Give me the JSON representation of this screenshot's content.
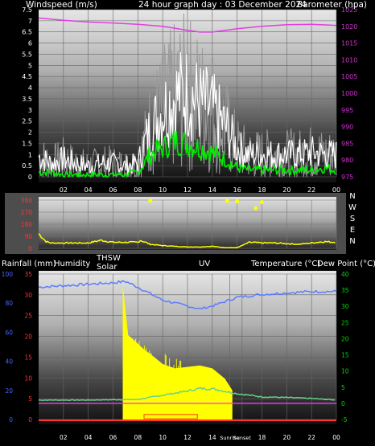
{
  "header": {
    "left": "Windspeed (m/s)",
    "center": "24 hour graph day : 03 December 2024",
    "right": "Barometer (hpa)"
  },
  "lower_header": {
    "rain": "Rainfall (mm)",
    "humidity": "Humidity",
    "thsw": "THSW",
    "solar": "Solar",
    "uv": "UV",
    "temp": "Temperature (°C)",
    "dew": "Dew Point (°C)"
  },
  "colors": {
    "wind": "#ffffff",
    "gust": "#9a9a9a",
    "avg_wind": "#00ee00",
    "barometer": "#e040e0",
    "direction": "#ffff00",
    "humidity": "#5b7cff",
    "temperature": "#66d28a",
    "dew": "#ff33ff",
    "solar": "#ffff00",
    "thsw": "#ff3333",
    "axis_red": "#ff3333",
    "axis_green": "#00dd00",
    "axis_purple": "#cc33cc"
  },
  "chart_data": [
    {
      "type": "line",
      "name": "wind-barometer",
      "x_tick_labels": [
        "02",
        "04",
        "06",
        "08",
        "10",
        "12",
        "14",
        "16",
        "18",
        "20",
        "22",
        "00"
      ],
      "y_left_ticks": [
        "0",
        "0.5",
        "1",
        "1.5",
        "2",
        "2.5",
        "3",
        "3.5",
        "4",
        "4.5",
        "5",
        "5.5",
        "6",
        "6.5",
        "7",
        "7.5"
      ],
      "y_left_range": [
        0,
        7.5
      ],
      "y_right_ticks": [
        "975",
        "980",
        "985",
        "990",
        "995",
        "1000",
        "1005",
        "1010",
        "1015",
        "1020",
        "1025"
      ],
      "y_right_range": [
        975,
        1025
      ],
      "series": [
        {
          "key": "wind",
          "x": [
            0,
            1,
            2,
            3,
            4,
            5,
            6,
            7,
            8,
            9,
            10,
            11,
            12,
            13,
            14,
            15,
            16,
            17,
            18,
            19,
            20,
            21,
            22,
            23,
            24
          ],
          "values": [
            0.9,
            0.6,
            0.8,
            0.6,
            0.5,
            0.6,
            0.6,
            0.5,
            0.6,
            2.2,
            3.0,
            3.6,
            3.8,
            3.3,
            3.0,
            2.3,
            1.3,
            1.0,
            1.0,
            1.0,
            1.0,
            1.0,
            1.1,
            1.0,
            1.0
          ]
        },
        {
          "key": "avg_wind",
          "x": [
            0,
            1,
            2,
            3,
            4,
            5,
            6,
            7,
            8,
            9,
            10,
            11,
            12,
            13,
            14,
            15,
            16,
            17,
            18,
            19,
            20,
            21,
            22,
            23,
            24
          ],
          "values": [
            0.2,
            0.2,
            0.1,
            0.1,
            0.1,
            0.1,
            0.1,
            0.1,
            0.2,
            1.0,
            1.3,
            1.6,
            1.5,
            1.3,
            1.1,
            0.8,
            0.4,
            0.3,
            0.3,
            0.3,
            0.3,
            0.3,
            0.3,
            0.4,
            0.3
          ]
        },
        {
          "key": "barometer",
          "x": [
            0,
            2,
            4,
            6,
            8,
            10,
            12,
            13,
            14,
            16,
            18,
            20,
            22,
            24
          ],
          "values": [
            1022.5,
            1021.8,
            1021.3,
            1021.0,
            1020.6,
            1020.0,
            1018.8,
            1018.3,
            1018.3,
            1019.3,
            1020.0,
            1020.5,
            1020.6,
            1020.3
          ]
        }
      ]
    },
    {
      "type": "scatter",
      "name": "wind-direction",
      "x_tick_labels": [
        "02",
        "04",
        "06",
        "08",
        "10",
        "12",
        "14",
        "16",
        "18",
        "20",
        "22",
        "00"
      ],
      "y_ticks": [
        "0",
        "90",
        "180",
        "270",
        "360"
      ],
      "y_range": [
        0,
        360
      ],
      "compass": [
        "N",
        "W",
        "S",
        "E",
        "N"
      ],
      "series": [
        {
          "key": "direction",
          "x": [
            0,
            0.3,
            0.6,
            1,
            2,
            3,
            4,
            5,
            6,
            6.4,
            7,
            8,
            8.2,
            9,
            10,
            11,
            12,
            13,
            14,
            15,
            16,
            17,
            18,
            19,
            20,
            21,
            22,
            23,
            24
          ],
          "values": [
            110,
            80,
            50,
            40,
            40,
            40,
            40,
            60,
            45,
            45,
            45,
            45,
            60,
            30,
            20,
            15,
            10,
            10,
            15,
            5,
            5,
            45,
            40,
            40,
            35,
            30,
            40,
            50,
            45
          ]
        }
      ]
    },
    {
      "type": "line",
      "name": "temperature-humidity-solar",
      "x_tick_labels": [
        "02",
        "04",
        "06",
        "08",
        "10",
        "12",
        "14",
        "Sunrise",
        "Sunset",
        "18",
        "20",
        "22",
        "00"
      ],
      "y_left_outer_ticks": [
        "0",
        "20",
        "40",
        "60",
        "80",
        "100"
      ],
      "y_left_inner_ticks": [
        "0",
        "5",
        "10",
        "15",
        "20",
        "25",
        "30",
        "35"
      ],
      "y_right_ticks": [
        "-5",
        "0",
        "5",
        "10",
        "15",
        "20",
        "25",
        "30",
        "35",
        "40"
      ],
      "y_right_range": [
        -5,
        40
      ],
      "series": [
        {
          "key": "humidity",
          "x": [
            0,
            2,
            4,
            6,
            7,
            8,
            10,
            12,
            13,
            14,
            16,
            18,
            20,
            22,
            24
          ],
          "values": [
            91,
            92,
            93,
            94,
            95,
            91,
            82,
            78,
            76,
            78,
            84,
            86,
            87,
            88,
            88
          ]
        },
        {
          "key": "temperature",
          "x": [
            0,
            2,
            4,
            6,
            8,
            10,
            12,
            13,
            14,
            16,
            18,
            20,
            22,
            24
          ],
          "values": [
            1.0,
            1.0,
            1.0,
            1.1,
            1.2,
            2.5,
            3.8,
            4.6,
            4.5,
            3.0,
            2.0,
            1.8,
            1.5,
            1.0
          ]
        },
        {
          "key": "dew",
          "x": [
            0,
            4,
            8,
            12,
            16,
            20,
            24
          ],
          "values": [
            -1.5,
            -1.5,
            -1.3,
            -1.4,
            -1.3,
            -1.2,
            -1.6
          ]
        },
        {
          "key": "solar",
          "x": [
            6.8,
            6.8,
            7.2,
            7.6,
            8,
            8.5,
            9,
            10,
            11,
            12,
            13,
            14,
            15,
            15.6,
            15.6
          ],
          "values": [
            0,
            90,
            58,
            55,
            52,
            48,
            45,
            38,
            35,
            36,
            37,
            35,
            28,
            20,
            0
          ]
        },
        {
          "key": "thsw",
          "x": [
            0,
            6.8,
            7.2,
            15.6,
            16,
            24
          ],
          "values": [
            0,
            0,
            0.5,
            0.5,
            0,
            0
          ]
        }
      ]
    }
  ]
}
